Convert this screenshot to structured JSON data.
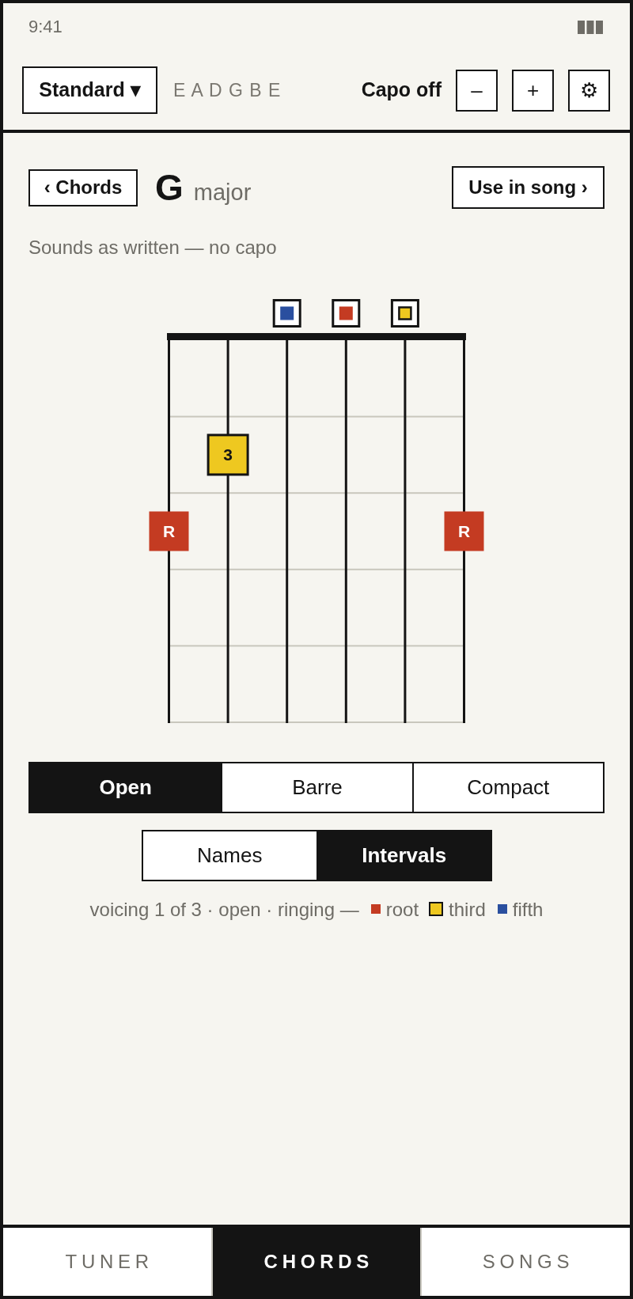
{
  "status_bar": {
    "time": "9:41"
  },
  "toolbar": {
    "tuning_button": "Standard ▾",
    "tuning_notes": "E A D G B E",
    "capo_label": "Capo off",
    "buttons": [
      "–",
      "+",
      "⚙"
    ]
  },
  "chord": {
    "back_button": "‹ Chords",
    "root": "G",
    "quality": "major",
    "action_button": "Use in song ›",
    "subtitle": "Sounds as written — no capo"
  },
  "diagram": {
    "open_row": [
      {
        "marker": false
      },
      {
        "marker": false
      },
      {
        "marker": true,
        "kind": "fifth",
        "color": "#2a4f9f"
      },
      {
        "marker": true,
        "kind": "root",
        "color": "#c43b22"
      },
      {
        "marker": true,
        "kind": "third",
        "color": "#eec820"
      },
      {
        "marker": false
      }
    ],
    "fret_rows": [
      [
        {
          "note": false
        },
        {
          "note": false
        },
        {
          "note": false
        },
        {
          "note": false
        },
        {
          "note": false
        },
        {
          "note": false
        }
      ],
      [
        {
          "note": false
        },
        {
          "note": true,
          "kind": "third",
          "color": "#eec820",
          "label": "3"
        },
        {
          "note": false
        },
        {
          "note": false
        },
        {
          "note": false
        },
        {
          "note": false
        }
      ],
      [
        {
          "note": true,
          "kind": "root",
          "color": "#c43b22",
          "label": "R"
        },
        {
          "note": false
        },
        {
          "note": false
        },
        {
          "note": false
        },
        {
          "note": false
        },
        {
          "note": true,
          "kind": "root",
          "color": "#c43b22",
          "label": "R"
        }
      ],
      [
        {
          "note": false
        },
        {
          "note": false
        },
        {
          "note": false
        },
        {
          "note": false
        },
        {
          "note": false
        },
        {
          "note": false
        }
      ],
      [
        {
          "note": false
        },
        {
          "note": false
        },
        {
          "note": false
        },
        {
          "note": false
        },
        {
          "note": false
        },
        {
          "note": false
        }
      ]
    ]
  },
  "voicing_tabs": [
    {
      "label": "Open",
      "selected": true
    },
    {
      "label": "Barre",
      "selected": false
    },
    {
      "label": "Compact",
      "selected": false
    }
  ],
  "label_tabs": [
    {
      "label": "Names",
      "selected": false
    },
    {
      "label": "Intervals",
      "selected": true
    }
  ],
  "legend": {
    "text": "voicing 1 of 3 · open · ringing —",
    "items": [
      {
        "kind": "root",
        "label": "root",
        "color": "#c43b22"
      },
      {
        "kind": "third",
        "label": "third",
        "color": "#eec820"
      },
      {
        "kind": "fifth",
        "label": "fifth",
        "color": "#2a4f9f"
      }
    ]
  },
  "bottom_nav": [
    {
      "label": "TUNER",
      "selected": false
    },
    {
      "label": "CHORDS",
      "selected": true
    },
    {
      "label": "SONGS",
      "selected": false
    }
  ]
}
